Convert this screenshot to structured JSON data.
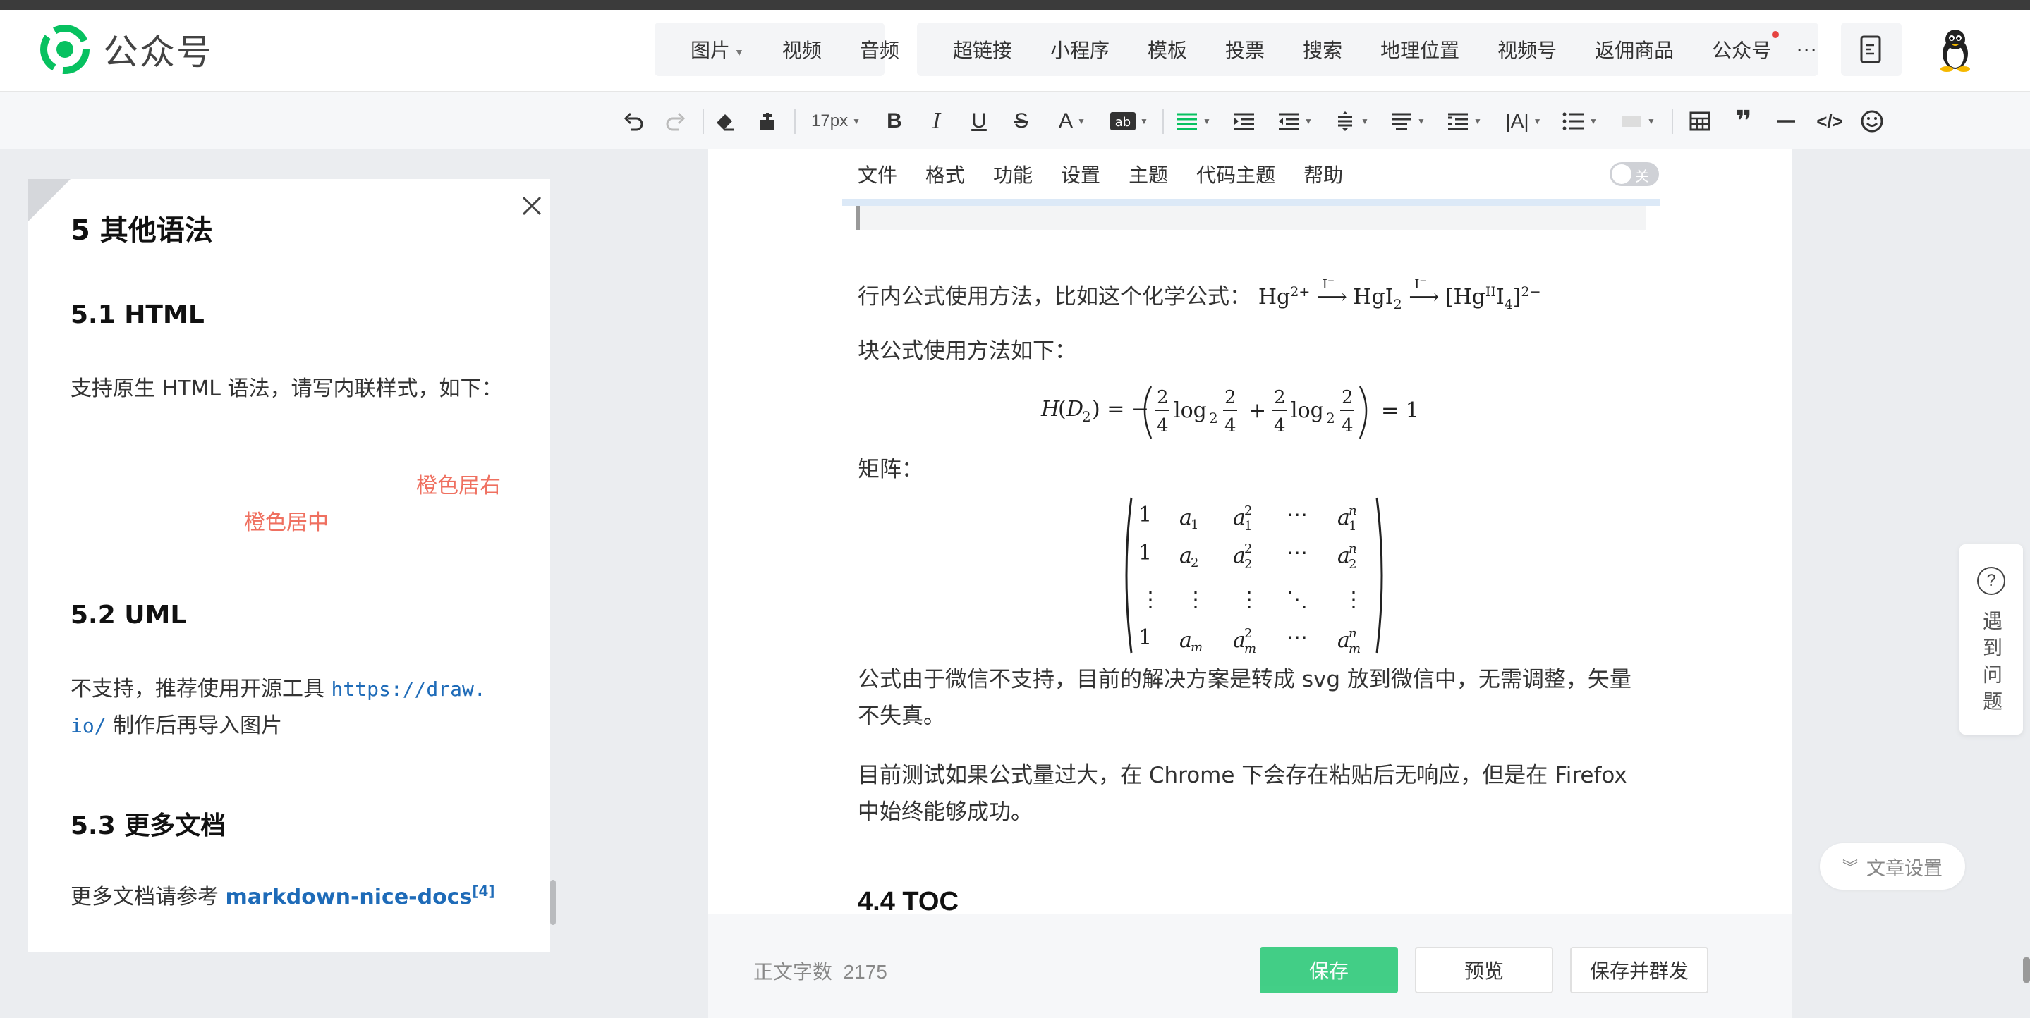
{
  "app": {
    "title": "公众号"
  },
  "header": {
    "menu_group_1": [
      {
        "label": "图片",
        "caret": true
      },
      {
        "label": "视频",
        "caret": false
      },
      {
        "label": "音频",
        "caret": false
      }
    ],
    "menu_group_2": [
      {
        "label": "超链接"
      },
      {
        "label": "小程序"
      },
      {
        "label": "模板"
      },
      {
        "label": "投票"
      },
      {
        "label": "搜索"
      },
      {
        "label": "地理位置"
      },
      {
        "label": "视频号"
      },
      {
        "label": "返佣商品"
      },
      {
        "label": "公众号"
      }
    ],
    "more": "···"
  },
  "toolbar": {
    "font_size": "17px"
  },
  "preview": {
    "h1": "5 其他语法",
    "h_html": "5.1 HTML",
    "p_html": "支持原生 HTML 语法，请写内联样式，如下：",
    "orange_right": "橙色居右",
    "orange_center": "橙色居中",
    "h_uml": "5.2 UML",
    "p_uml_1": "不支持，推荐使用开源工具 ",
    "p_uml_code_1": "https://draw.",
    "p_uml_code_2": "io/",
    "p_uml_2": " 制作后再导入图片",
    "h_docs": "5.3 更多文档",
    "p_docs": "更多文档请参考 ",
    "p_docs_link": "markdown-nice-docs",
    "p_docs_sup": "[4]"
  },
  "editor": {
    "menu": [
      "文件",
      "格式",
      "功能",
      "设置",
      "主题",
      "代码主题",
      "帮助"
    ],
    "toggle_label": "关",
    "inline_formula_text": "行内公式使用方法，比如这个化学公式：",
    "block_formula_text": "块公式使用方法如下：",
    "matrix_text": "矩阵：",
    "p_svg": "公式由于微信不支持，目前的解决方案是转成 svg 放到微信中，无需调整，矢量不失真。",
    "p_chrome": "目前测试如果公式量过大，在 Chrome 下会存在粘贴后无响应，但是在 Firefox 中始终能够成功。",
    "h_toc": "4.4 TOC"
  },
  "footer": {
    "wordcount_label": "正文字数",
    "wordcount_value": "2175",
    "save": "保存",
    "preview": "预览",
    "save_publish": "保存并群发"
  },
  "side": {
    "help": "遇到问题",
    "article_settings": "文章设置"
  },
  "colors": {
    "brand_green": "#07c160",
    "orange_text": "#ef7060",
    "link_blue": "#1e6bb8"
  }
}
